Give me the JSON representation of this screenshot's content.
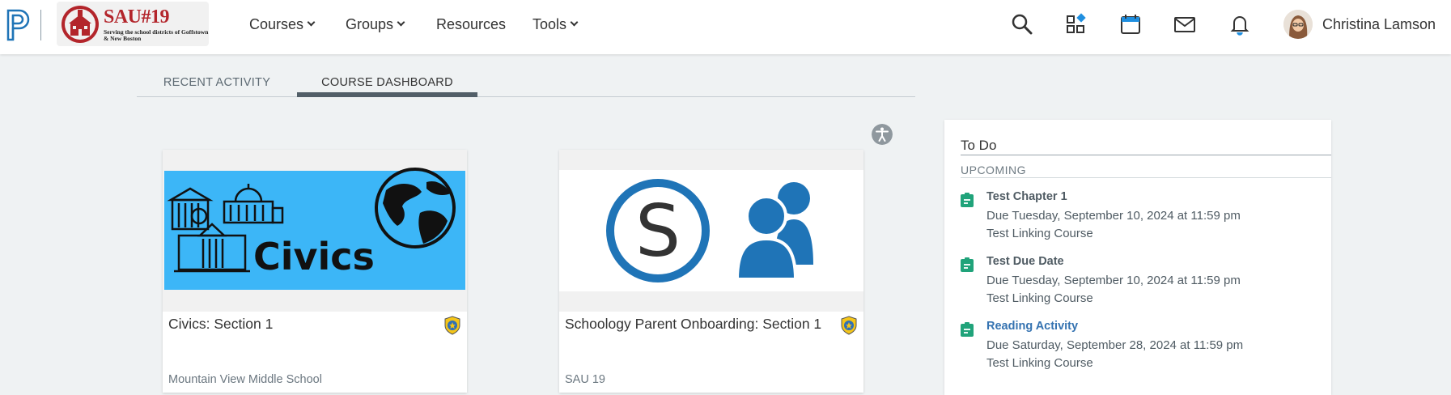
{
  "header": {
    "school_logo": {
      "title": "SAU#19",
      "subtitle": "Serving the school districts of Goffstown & New Boston"
    },
    "nav": [
      {
        "label": "Courses",
        "has_dropdown": true
      },
      {
        "label": "Groups",
        "has_dropdown": true
      },
      {
        "label": "Resources",
        "has_dropdown": false
      },
      {
        "label": "Tools",
        "has_dropdown": true
      }
    ],
    "icons": [
      "search-icon",
      "apps-icon",
      "calendar-icon",
      "mail-icon",
      "bell-icon"
    ],
    "user": {
      "name": "Christina Lamson"
    }
  },
  "tabs": [
    {
      "label": "RECENT ACTIVITY",
      "active": false
    },
    {
      "label": "COURSE DASHBOARD",
      "active": true
    }
  ],
  "courses": [
    {
      "title": "Civics: Section 1",
      "school": "Mountain View Middle School",
      "image_text": "Civics",
      "image_bg": "#3cb6f7"
    },
    {
      "title": "Schoology Parent Onboarding: Section 1",
      "school": "SAU 19",
      "image_bg": "#ffffff"
    }
  ],
  "todo": {
    "title": "To Do",
    "section": "UPCOMING",
    "items": [
      {
        "name": "Test Chapter 1",
        "due": "Due Tuesday, September 10, 2024 at 11:59 pm",
        "course": "Test Linking Course",
        "is_link": false
      },
      {
        "name": "Test Due Date",
        "due": "Due Tuesday, September 10, 2024 at 11:59 pm",
        "course": "Test Linking Course",
        "is_link": false
      },
      {
        "name": "Reading Activity",
        "due": "Due Saturday, September 28, 2024 at 11:59 pm",
        "course": "Test Linking Course",
        "is_link": true
      }
    ]
  },
  "colors": {
    "accent": "#1f74b7",
    "tab_active_underline": "#525f68",
    "todo_icon": "#20a37a",
    "link": "#3573b1"
  }
}
